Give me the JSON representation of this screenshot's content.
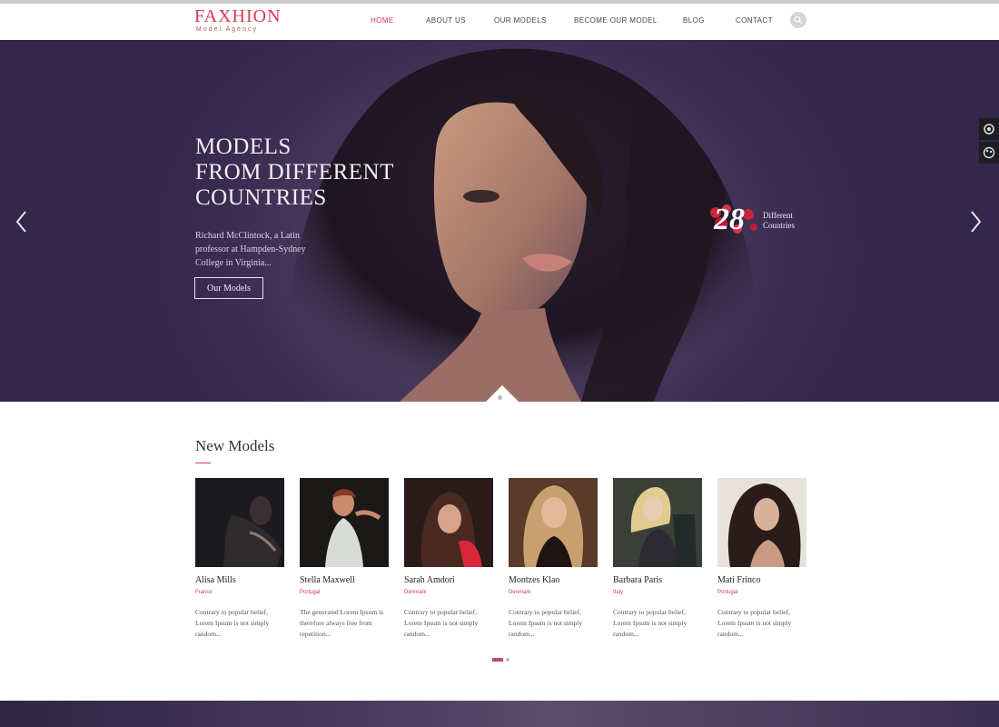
{
  "brand": {
    "name": "FAXHION",
    "tagline": "Model Agency"
  },
  "nav": [
    {
      "label": "HOME",
      "active": true
    },
    {
      "label": "ABOUT US",
      "active": false
    },
    {
      "label": "OUR MODELS",
      "active": false
    },
    {
      "label": "BECOME OUR MODEL",
      "active": false
    },
    {
      "label": "BLOG",
      "active": false
    },
    {
      "label": "CONTACT",
      "active": false
    }
  ],
  "hero": {
    "title_lines": [
      "MODELS",
      "FROM DIFFERENT",
      "COUNTRIES"
    ],
    "text": "Richard McClintock, a Latin professor at Hampden-Sydney College in Virginia...",
    "button_label": "Our Models",
    "badge": {
      "number": "28",
      "line1": "Different",
      "line2": "Countries"
    }
  },
  "section": {
    "title": "New Models"
  },
  "models": [
    {
      "name": "Alisa Mills",
      "country": "France",
      "description": "Contrary to popular belief, Lorem Ipsum is not simply random..."
    },
    {
      "name": "Stella Maxwell",
      "country": "Portugal",
      "description": "The generated Lorem Ipsum is therefore always free from repetition..."
    },
    {
      "name": "Sarah Amdori",
      "country": "Denmark",
      "description": "Contrary to popular belief, Lorem Ipsum is not simply random..."
    },
    {
      "name": "Montzes Klao",
      "country": "Denmark",
      "description": "Contrary to popular belief, Lorem Ipsum is not simply random..."
    },
    {
      "name": "Barbara Paris",
      "country": "Italy",
      "description": "Contrary to popular belief, Lorem Ipsum is not simply random..."
    },
    {
      "name": "Mati Frinco",
      "country": "Portugal",
      "description": "Contrary to popular belief, Lorem Ipsum is not simply random..."
    }
  ],
  "colors": {
    "accent": "#d83a52",
    "hero_bg": "#3a2c52"
  }
}
